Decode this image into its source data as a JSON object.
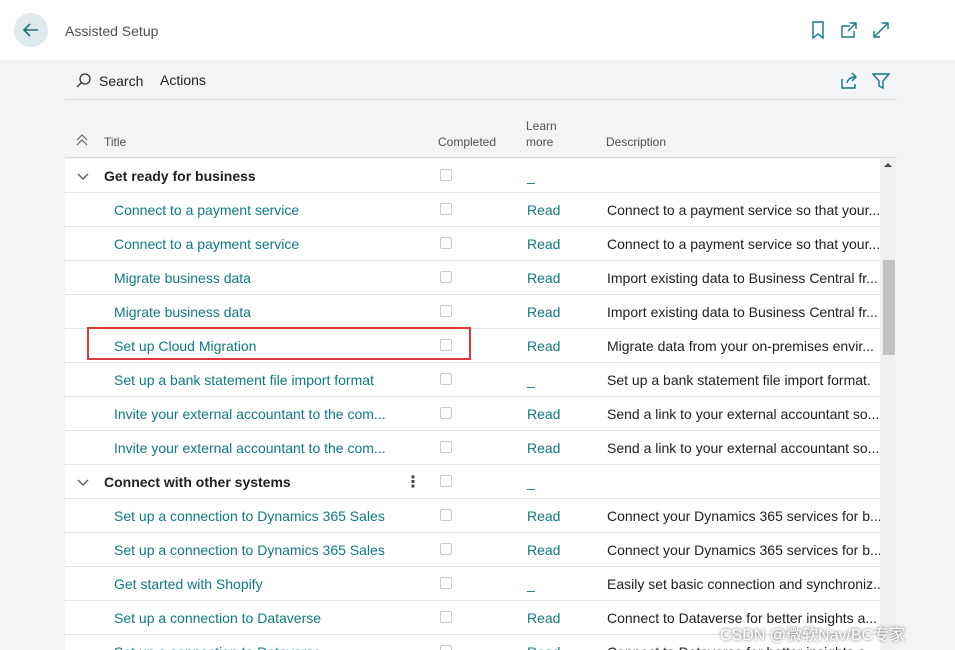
{
  "header": {
    "page_title": "Assisted Setup"
  },
  "actionbar": {
    "search_label": "Search",
    "actions_label": "Actions"
  },
  "columns": {
    "title": "Title",
    "completed": "Completed",
    "learn_more_line1": "Learn",
    "learn_more_line2": "more",
    "description": "Description"
  },
  "rows": [
    {
      "type": "group",
      "title": "Get ready for business",
      "learn": "_",
      "desc": ""
    },
    {
      "type": "item",
      "title": "Connect to a payment service",
      "learn": "Read",
      "desc": "Connect to a payment service so that your..."
    },
    {
      "type": "item",
      "title": "Connect to a payment service",
      "learn": "Read",
      "desc": "Connect to a payment service so that your..."
    },
    {
      "type": "item",
      "title": "Migrate business data",
      "learn": "Read",
      "desc": "Import existing data to Business Central fr..."
    },
    {
      "type": "item",
      "title": "Migrate business data",
      "learn": "Read",
      "desc": "Import existing data to Business Central fr..."
    },
    {
      "type": "item",
      "title": "Set up Cloud Migration",
      "learn": "Read",
      "desc": "Migrate data from your on-premises envir..."
    },
    {
      "type": "item",
      "title": "Set up a bank statement file import format",
      "learn": "_",
      "desc": "Set up a bank statement file import format."
    },
    {
      "type": "item",
      "title": "Invite your external accountant to the com...",
      "learn": "Read",
      "desc": "Send a link to your external accountant so..."
    },
    {
      "type": "item",
      "title": "Invite your external accountant to the com...",
      "learn": "Read",
      "desc": "Send a link to your external accountant so..."
    },
    {
      "type": "group",
      "title": "Connect with other systems",
      "learn": "_",
      "desc": "",
      "more": "⋮"
    },
    {
      "type": "item",
      "title": "Set up a connection to Dynamics 365 Sales",
      "learn": "Read",
      "desc": "Connect your Dynamics 365 services for b..."
    },
    {
      "type": "item",
      "title": "Set up a connection to Dynamics 365 Sales",
      "learn": "Read",
      "desc": "Connect your Dynamics 365 services for b..."
    },
    {
      "type": "item",
      "title": "Get started with Shopify",
      "learn": "_",
      "desc": "Easily set basic connection and synchroniz..."
    },
    {
      "type": "item",
      "title": "Set up a connection to Dataverse",
      "learn": "Read",
      "desc": "Connect to Dataverse for better insights a..."
    },
    {
      "type": "item",
      "title": "Set up a connection to Dataverse",
      "learn": "Read",
      "desc": "Connect to Dataverse for better insights a..."
    }
  ],
  "watermark": "CSDN @微软Nav/BC专家",
  "colors": {
    "accent": "#0f7a84",
    "highlight": "#e0383a"
  }
}
